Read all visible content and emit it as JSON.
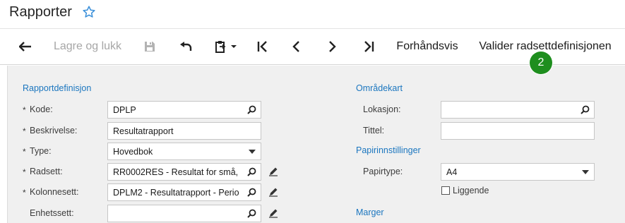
{
  "page": {
    "title": "Rapporter"
  },
  "toolbar": {
    "back_label": "Tilbake",
    "save_close_label": "Lagre og lukk",
    "preview_label": "Forhåndsvis",
    "validate_label": "Valider radsettdefinisjonen",
    "step_badge": "2"
  },
  "left": {
    "section_title": "Rapportdefinisjon",
    "fields": [
      {
        "label": "Kode:",
        "value": "DPLP",
        "required": true
      },
      {
        "label": "Beskrivelse:",
        "value": "Resultatrapport",
        "required": true
      },
      {
        "label": "Type:",
        "value": "Hovedbok",
        "required": true
      },
      {
        "label": "Radsett:",
        "value": "RR0002RES - Resultat for små,",
        "required": true
      },
      {
        "label": "Kolonnesett:",
        "value": "DPLM2 - Resultatrapport - Perio",
        "required": true
      },
      {
        "label": "Enhetssett:",
        "value": "",
        "required": false
      }
    ],
    "required_mark": "*"
  },
  "right": {
    "area_section_title": "Områdekart",
    "location_label": "Lokasjon:",
    "location_value": "",
    "title_label": "Tittel:",
    "title_value": "",
    "paper_section_title": "Papirinnstillinger",
    "paper_type_label": "Papirtype:",
    "paper_type_value": "A4",
    "landscape_label": "Liggende",
    "margins_section_title": "Marger"
  },
  "colors": {
    "accent": "#1b76bf",
    "badge": "#1e8e1e",
    "star": "#3a8fd9"
  }
}
